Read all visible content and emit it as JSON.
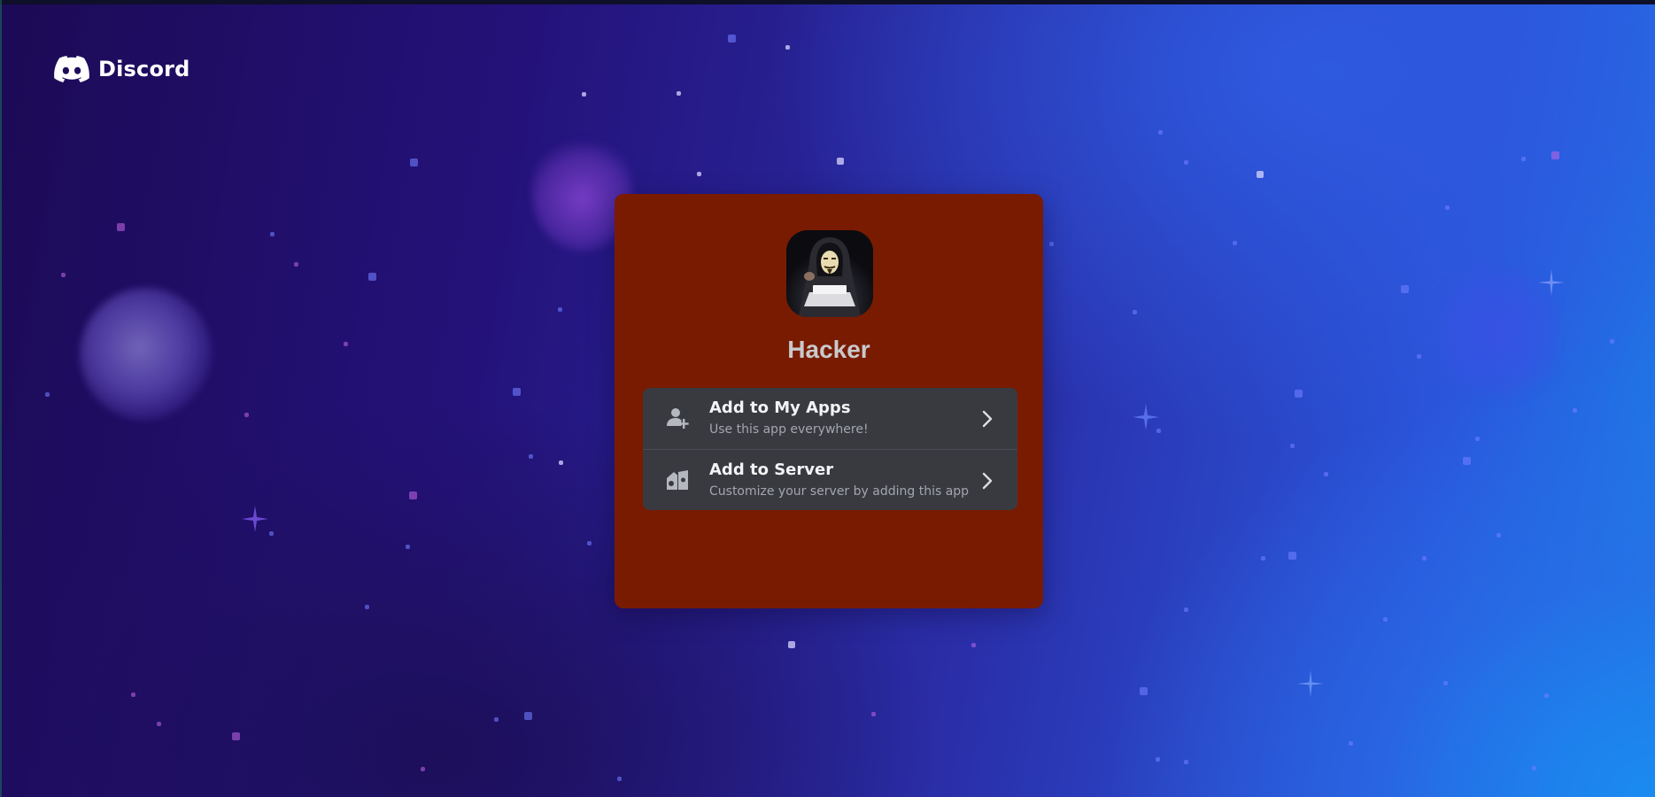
{
  "brand": {
    "logo_text": "Discord",
    "logo_icon": "discord-icon"
  },
  "app": {
    "name": "Hacker",
    "avatar": "hacker-avatar-image"
  },
  "options": [
    {
      "title": "Add to My Apps",
      "subtitle": "Use this app everywhere!",
      "icon": "user-add-icon"
    },
    {
      "title": "Add to Server",
      "subtitle": "Customize your server by adding this app",
      "icon": "server-add-icon"
    }
  ],
  "colors": {
    "card": "#791b00",
    "options_bg": "#393a40",
    "title_text": "#f2f3f5",
    "subtitle_text": "#a3a6ad"
  }
}
